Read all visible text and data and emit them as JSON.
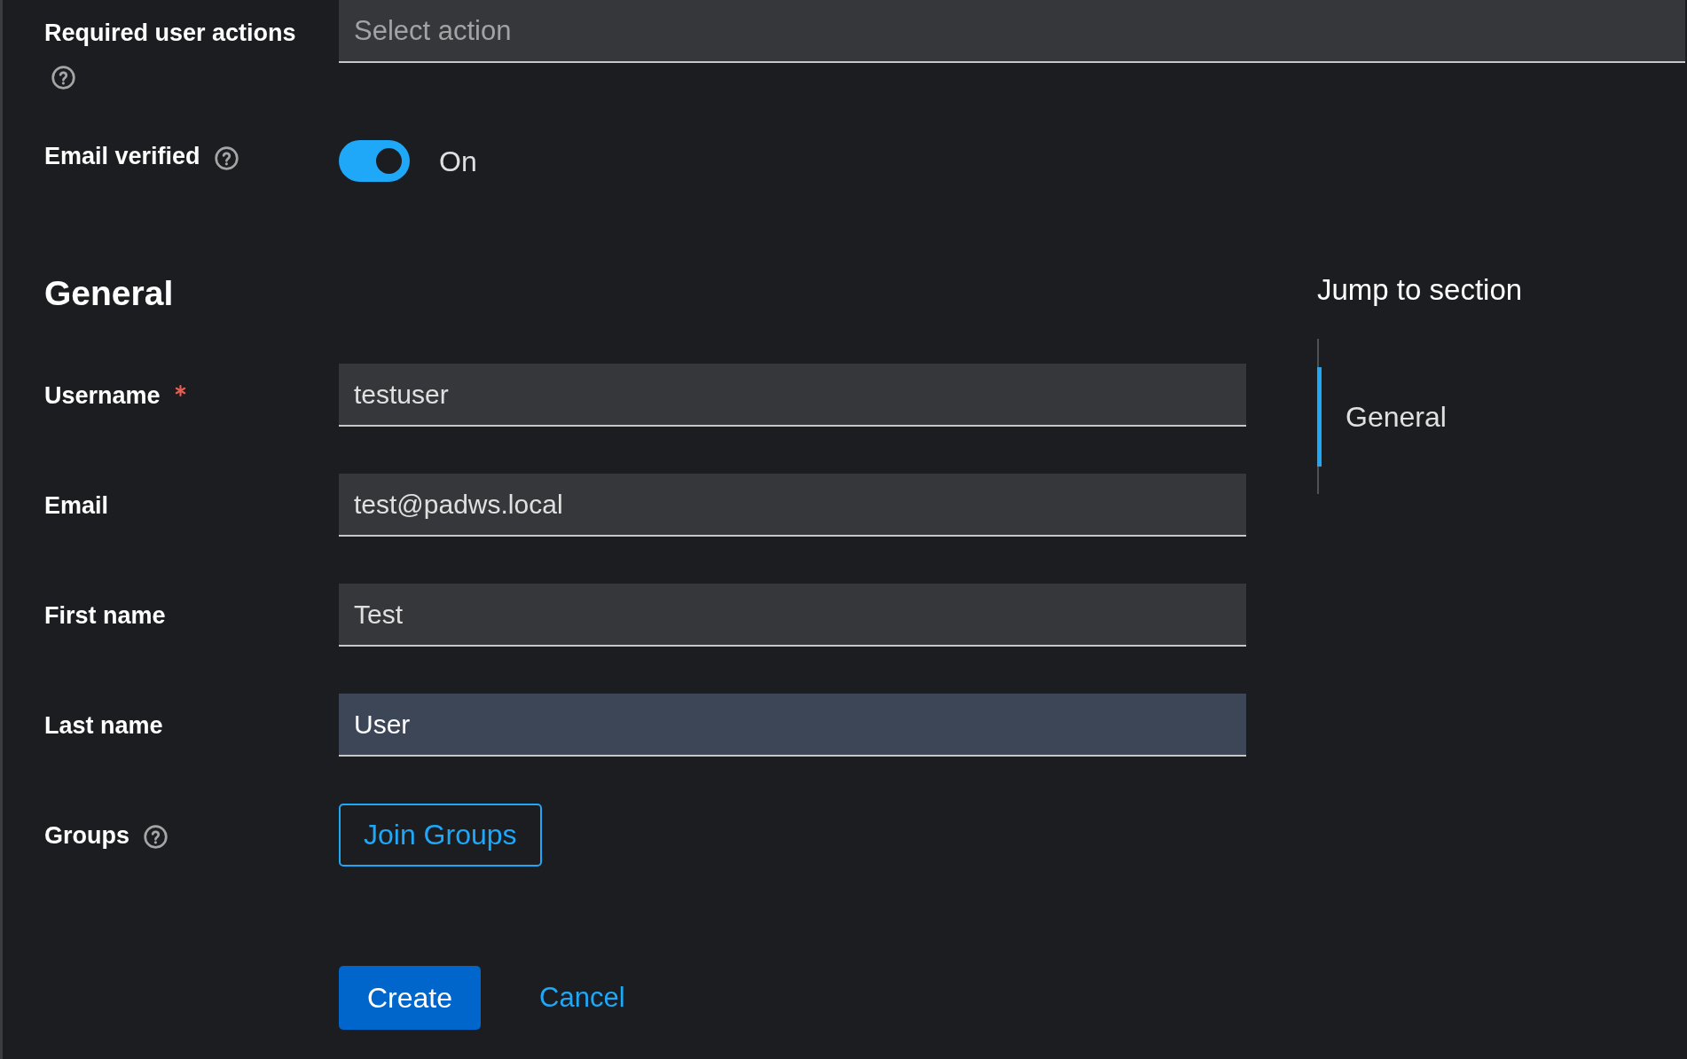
{
  "form": {
    "rows": [
      {
        "kind": "select",
        "label": "Required user actions",
        "help": true,
        "placeholder": "Select action"
      },
      {
        "kind": "switch",
        "label": "Email verified",
        "help": true,
        "on": true,
        "state_label": "On"
      }
    ]
  },
  "general": {
    "title": "General",
    "rows": [
      {
        "kind": "text",
        "label": "Username",
        "required": true,
        "value": "testuser",
        "highlighted": false
      },
      {
        "kind": "text",
        "label": "Email",
        "required": false,
        "value": "test@padws.local",
        "highlighted": false
      },
      {
        "kind": "text",
        "label": "First name",
        "required": false,
        "value": "Test",
        "highlighted": false
      },
      {
        "kind": "text",
        "label": "Last name",
        "required": false,
        "value": "User",
        "highlighted": true
      },
      {
        "kind": "button",
        "label": "Groups",
        "help": true,
        "button": "Join Groups"
      }
    ]
  },
  "actions": [
    {
      "kind": "primary",
      "label": "Create"
    },
    {
      "kind": "link",
      "label": "Cancel"
    }
  ],
  "jump_to_section": {
    "title": "Jump to section",
    "items": [
      {
        "label": "General",
        "selected": true
      }
    ]
  }
}
